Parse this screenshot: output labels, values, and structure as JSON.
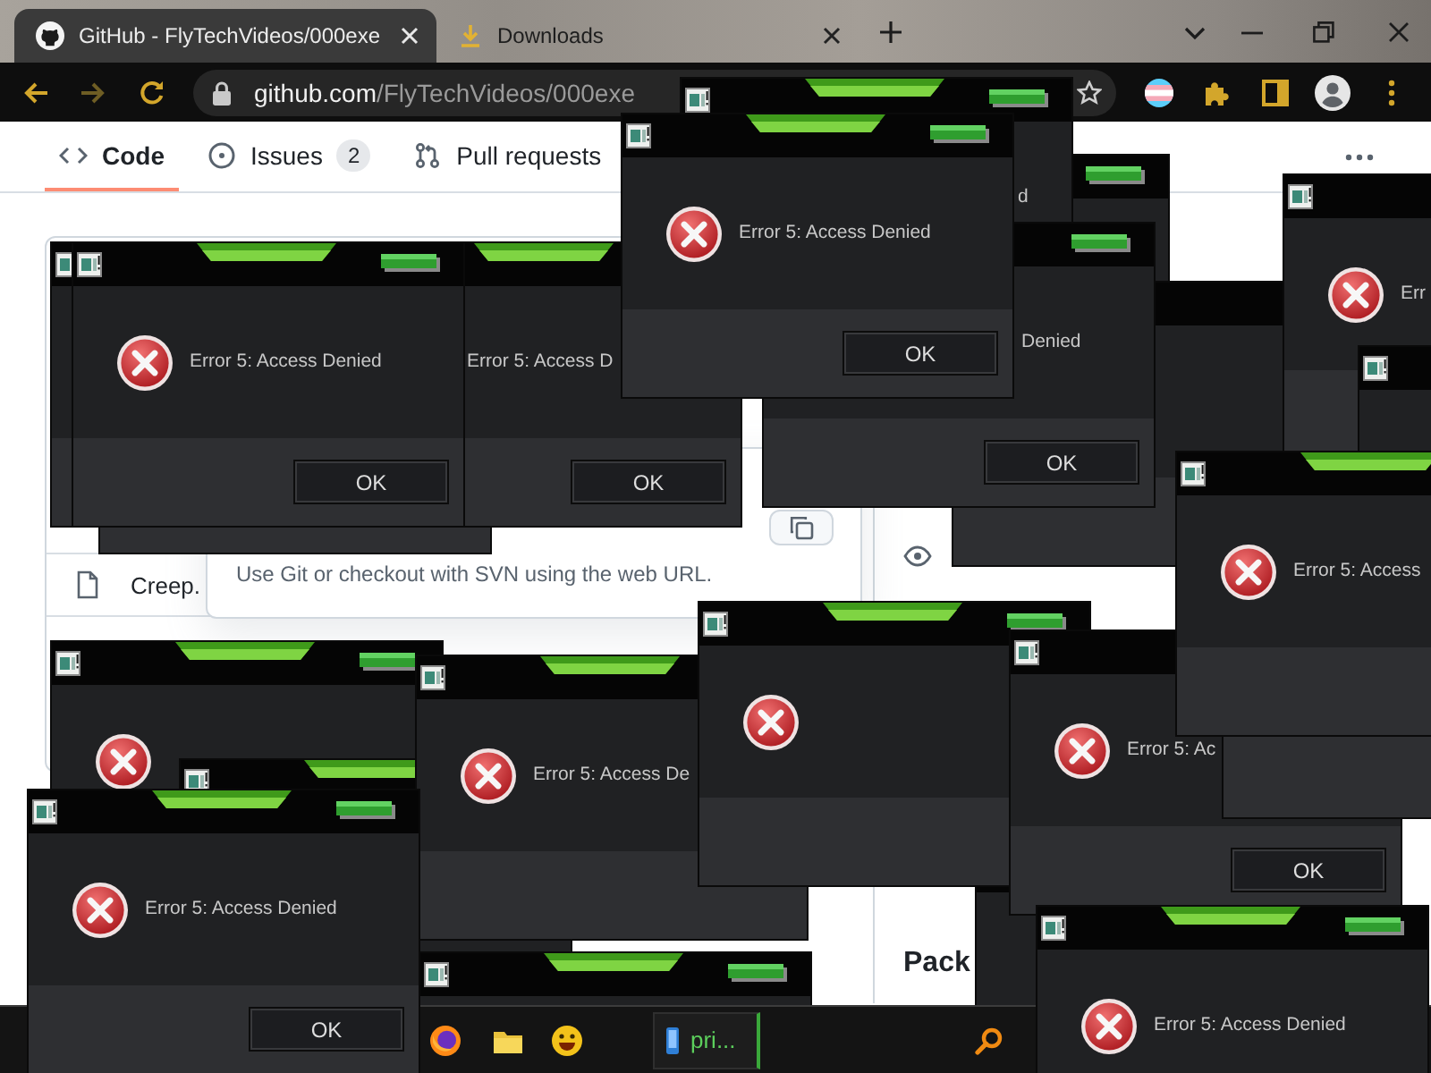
{
  "browser": {
    "tabs": [
      {
        "title": "GitHub - FlyTechVideos/000exe",
        "selected": true
      },
      {
        "title": "Downloads",
        "selected": false
      }
    ],
    "address": {
      "host": "github.com",
      "path": "/FlyTechVideos/000exe"
    }
  },
  "repo_nav": [
    {
      "label": "Code",
      "selected": true
    },
    {
      "label": "Issues",
      "count": "2",
      "selected": false
    },
    {
      "label": "Pull requests",
      "selected": false
    }
  ],
  "file_list": {
    "rows": [
      {
        "name": "Creep."
      }
    ]
  },
  "clone_popup": {
    "hint": "Use Git or checkout with SVN using the web URL."
  },
  "sidebar": {
    "heading": "Pack"
  },
  "dialogs": [
    {
      "icon_visible": false
    },
    {
      "message": "d",
      "icon_visible": false
    },
    {
      "icon_visible": false
    },
    {
      "message": "Denied",
      "button": "OK",
      "icon_visible": false
    },
    {
      "icon_visible": false
    },
    {
      "icon_visible": false
    },
    {
      "message": "Error 5: Access D",
      "button": "OK",
      "icon_visible": false
    },
    {
      "message": "Error 5: Access Denied",
      "button": "OK",
      "icon_visible": true
    },
    {
      "message": "Error 5: Access Denied",
      "button": "OK",
      "icon_visible": true
    },
    {
      "message": "Err",
      "icon_visible": true
    },
    {
      "icon_visible": false
    },
    {
      "icon_visible": true
    },
    {
      "icon_visible": false
    },
    {
      "message": "Error 5: Access De",
      "icon_visible": true
    },
    {
      "icon_visible": false
    },
    {
      "icon_visible": false
    },
    {
      "icon_visible": true
    },
    {
      "message": "Error 5: Ac",
      "button": "OK",
      "icon_visible": true
    },
    {
      "icon_visible": false
    },
    {
      "message": "Error 5: Access",
      "icon_visible": true
    },
    {
      "message": "Error 5: Access Denied",
      "button": "OK",
      "icon_visible": true
    },
    {
      "message": "Error 5: Access Denied",
      "icon_visible": true
    }
  ],
  "taskbar": {
    "buttons": [
      {
        "label": "pri..."
      }
    ]
  }
}
